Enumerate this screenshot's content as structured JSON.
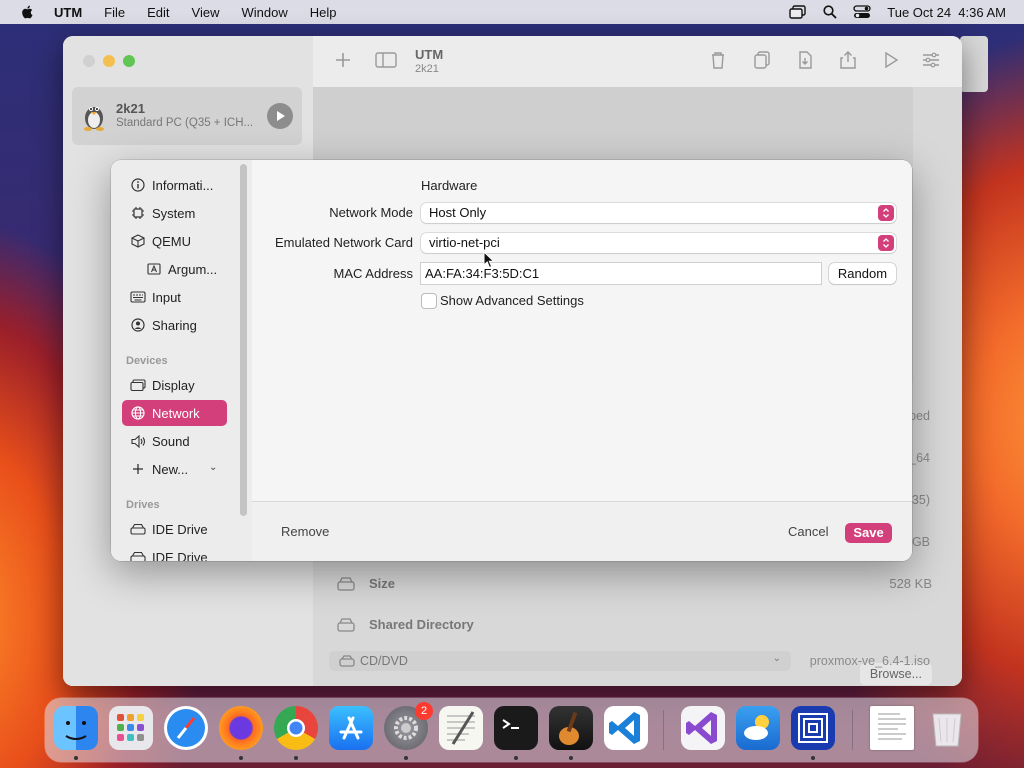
{
  "menubar": {
    "app_name": "UTM",
    "items": [
      "File",
      "Edit",
      "View",
      "Window",
      "Help"
    ],
    "clock": "Tue Oct 24  4:36 AM"
  },
  "utm_window": {
    "vm": {
      "name": "2k21",
      "subtitle": "Standard PC (Q35 + ICH..."
    },
    "toolbar": {
      "title": "UTM",
      "subtitle": "2k21"
    },
    "details": {
      "size_label": "Size",
      "size_value": "528 KB",
      "shared_dir_label": "Shared Directory",
      "browse_label": "Browse...",
      "cd_label": "CD/DVD",
      "cd_value": "proxmox-ve_6.4-1.iso",
      "frag_1": "ped",
      "frag_2": "_64",
      "frag_3": "35)",
      "frag_4": "GB"
    }
  },
  "sheet": {
    "sidebar": {
      "items_top": [
        {
          "label": "Informati...",
          "icon": "info-icon"
        },
        {
          "label": "System",
          "icon": "cpu-icon"
        },
        {
          "label": "QEMU",
          "icon": "cube-icon"
        },
        {
          "label": "Argum...",
          "icon": "arguments-icon"
        },
        {
          "label": "Input",
          "icon": "keyboard-icon"
        },
        {
          "label": "Sharing",
          "icon": "person-icon"
        }
      ],
      "devices_header": "Devices",
      "devices": [
        {
          "label": "Display",
          "icon": "display-icon"
        },
        {
          "label": "Network",
          "icon": "globe-icon"
        },
        {
          "label": "Sound",
          "icon": "speaker-icon"
        },
        {
          "label": "New...",
          "icon": "plus-icon"
        }
      ],
      "drives_header": "Drives",
      "drives": [
        {
          "label": "IDE Drive",
          "icon": "drive-icon"
        },
        {
          "label": "IDE Drive",
          "icon": "drive-icon"
        }
      ]
    },
    "form": {
      "section_title": "Hardware",
      "network_mode_label": "Network Mode",
      "network_mode_value": "Host Only",
      "network_card_label": "Emulated Network Card",
      "network_card_value": "virtio-net-pci",
      "mac_label": "MAC Address",
      "mac_value": "AA:FA:34:F3:5D:C1",
      "random_label": "Random",
      "advanced_label": "Show Advanced Settings",
      "advanced_checked": false
    },
    "footer": {
      "remove_label": "Remove",
      "cancel_label": "Cancel",
      "save_label": "Save"
    }
  },
  "dock": {
    "apps": [
      "finder",
      "launchpad",
      "safari",
      "firefox",
      "chrome",
      "app-store",
      "system-settings",
      "textedit",
      "terminal",
      "garageband",
      "vscode",
      "visual-studio",
      "icloud",
      "utm",
      "document",
      "trash"
    ],
    "settings_badge": "2"
  },
  "colors": {
    "accent": "#d33f7a"
  }
}
